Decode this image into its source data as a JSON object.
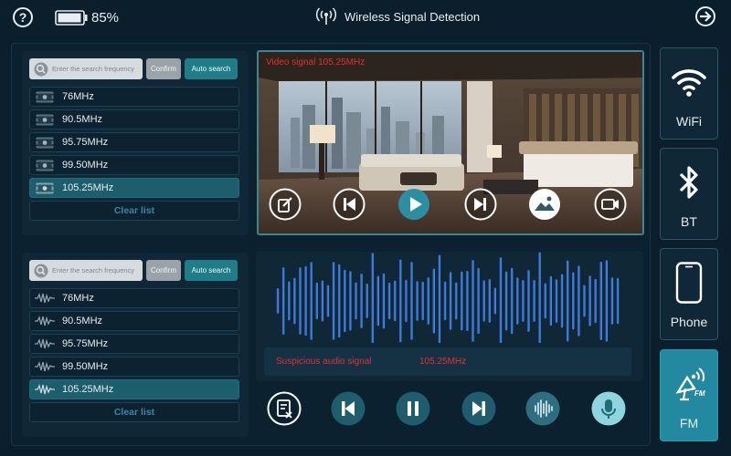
{
  "status_bar": {
    "battery_text": "85%"
  },
  "app": {
    "title": "Wireless Signal Detection"
  },
  "search_panels": [
    {
      "placeholder": "Enter the search frequency",
      "confirm_label": "Confirm",
      "auto_label": "Auto search",
      "items": [
        "76MHz",
        "90.5MHz",
        "95.75MHz",
        "99.50MHz",
        "105.25MHz"
      ],
      "selected_index": 4,
      "item_icon": "video-signal-icon",
      "clear_label": "Clear list"
    },
    {
      "placeholder": "Enter the search frequency",
      "confirm_label": "Confirm",
      "auto_label": "Auto search",
      "items": [
        "76MHz",
        "90.5MHz",
        "95.75MHz",
        "99.50MHz",
        "105.25MHz"
      ],
      "selected_index": 4,
      "item_icon": "audio-waveform-icon",
      "clear_label": "Clear list"
    }
  ],
  "video": {
    "label": "Video signal  105.25MHz",
    "controls": [
      "edit-icon",
      "previous-icon",
      "play-icon",
      "next-icon",
      "image-icon",
      "record-video-icon"
    ]
  },
  "audio": {
    "alert_label": "Suspicious audio signal",
    "alert_frequency": "105.25MHz",
    "controls": [
      "clear-log-icon",
      "previous-icon",
      "pause-icon",
      "next-icon",
      "waveform-icon",
      "microphone-icon"
    ]
  },
  "side_tabs": [
    {
      "label": "WiFi",
      "icon": "wifi-icon"
    },
    {
      "label": "BT",
      "icon": "bluetooth-icon"
    },
    {
      "label": "Phone",
      "icon": "phone-icon"
    },
    {
      "label": "FM",
      "icon": "fm-antenna-icon",
      "active": true
    }
  ],
  "colors": {
    "background": "#0a1e2c",
    "panel": "#0f2736",
    "accent": "#1f7d88",
    "selected_row": "#1c5e6c",
    "alert_red": "#e23030",
    "active_tab": "#2389a0"
  }
}
